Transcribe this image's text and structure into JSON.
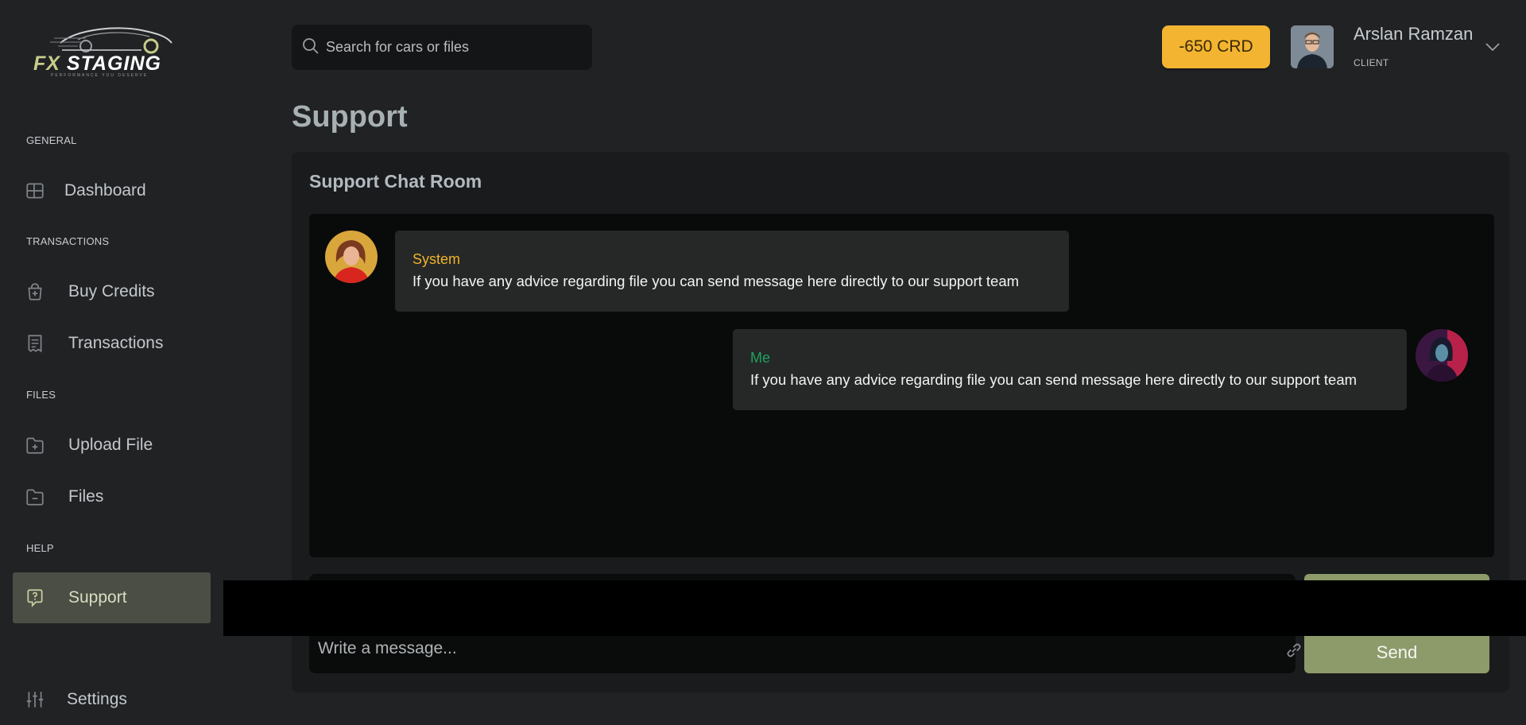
{
  "brand": {
    "logo_text_a": "FX",
    "logo_text_b": "STAGING",
    "tagline": "PERFORMANCE YOU DESERVE"
  },
  "sidebar": {
    "sections": [
      {
        "label": "GENERAL"
      },
      {
        "label": "TRANSACTIONS"
      },
      {
        "label": "FILES"
      },
      {
        "label": "HELP"
      }
    ],
    "items": [
      {
        "label": "Dashboard",
        "icon": "grid-icon"
      },
      {
        "label": "Buy Credits",
        "icon": "cart-plus-icon"
      },
      {
        "label": "Transactions",
        "icon": "receipt-icon"
      },
      {
        "label": "Upload File",
        "icon": "folder-plus-icon"
      },
      {
        "label": "Files",
        "icon": "folder-minus-icon"
      },
      {
        "label": "Support",
        "icon": "help-chat-icon",
        "active": true
      },
      {
        "label": "Settings",
        "icon": "sliders-icon"
      }
    ]
  },
  "header": {
    "search_placeholder": "Search for cars or files",
    "credits": "-650 CRD",
    "user_name": "Arslan Ramzan",
    "user_role": "CLIENT"
  },
  "page": {
    "title": "Support"
  },
  "chat": {
    "title": "Support Chat Room",
    "messages": [
      {
        "sender": "System",
        "sender_color": "#f0b429",
        "text": "If you have any advice regarding file you can send message here directly to our support team"
      },
      {
        "sender": "Me",
        "sender_color": "#1fa25b",
        "text": "If you have any advice regarding file you can send message here directly to our support team"
      }
    ],
    "input_placeholder": "Write a message...",
    "send_label": "Send"
  },
  "colors": {
    "accent": "#8d9a6a",
    "credits_bg": "#f3b431",
    "background": "#212224"
  }
}
